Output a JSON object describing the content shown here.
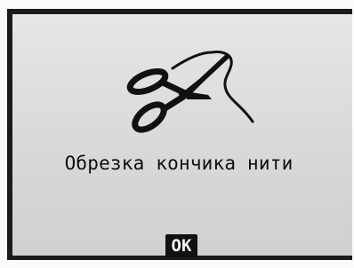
{
  "screen": {
    "icon": "scissors-cutting-thread-icon",
    "message": "Обрезка кончика нити",
    "ok_label": "OK"
  },
  "colors": {
    "lcd_background": "#dcdcdc",
    "foreground": "#111111",
    "button_text": "#f2f2f2"
  }
}
